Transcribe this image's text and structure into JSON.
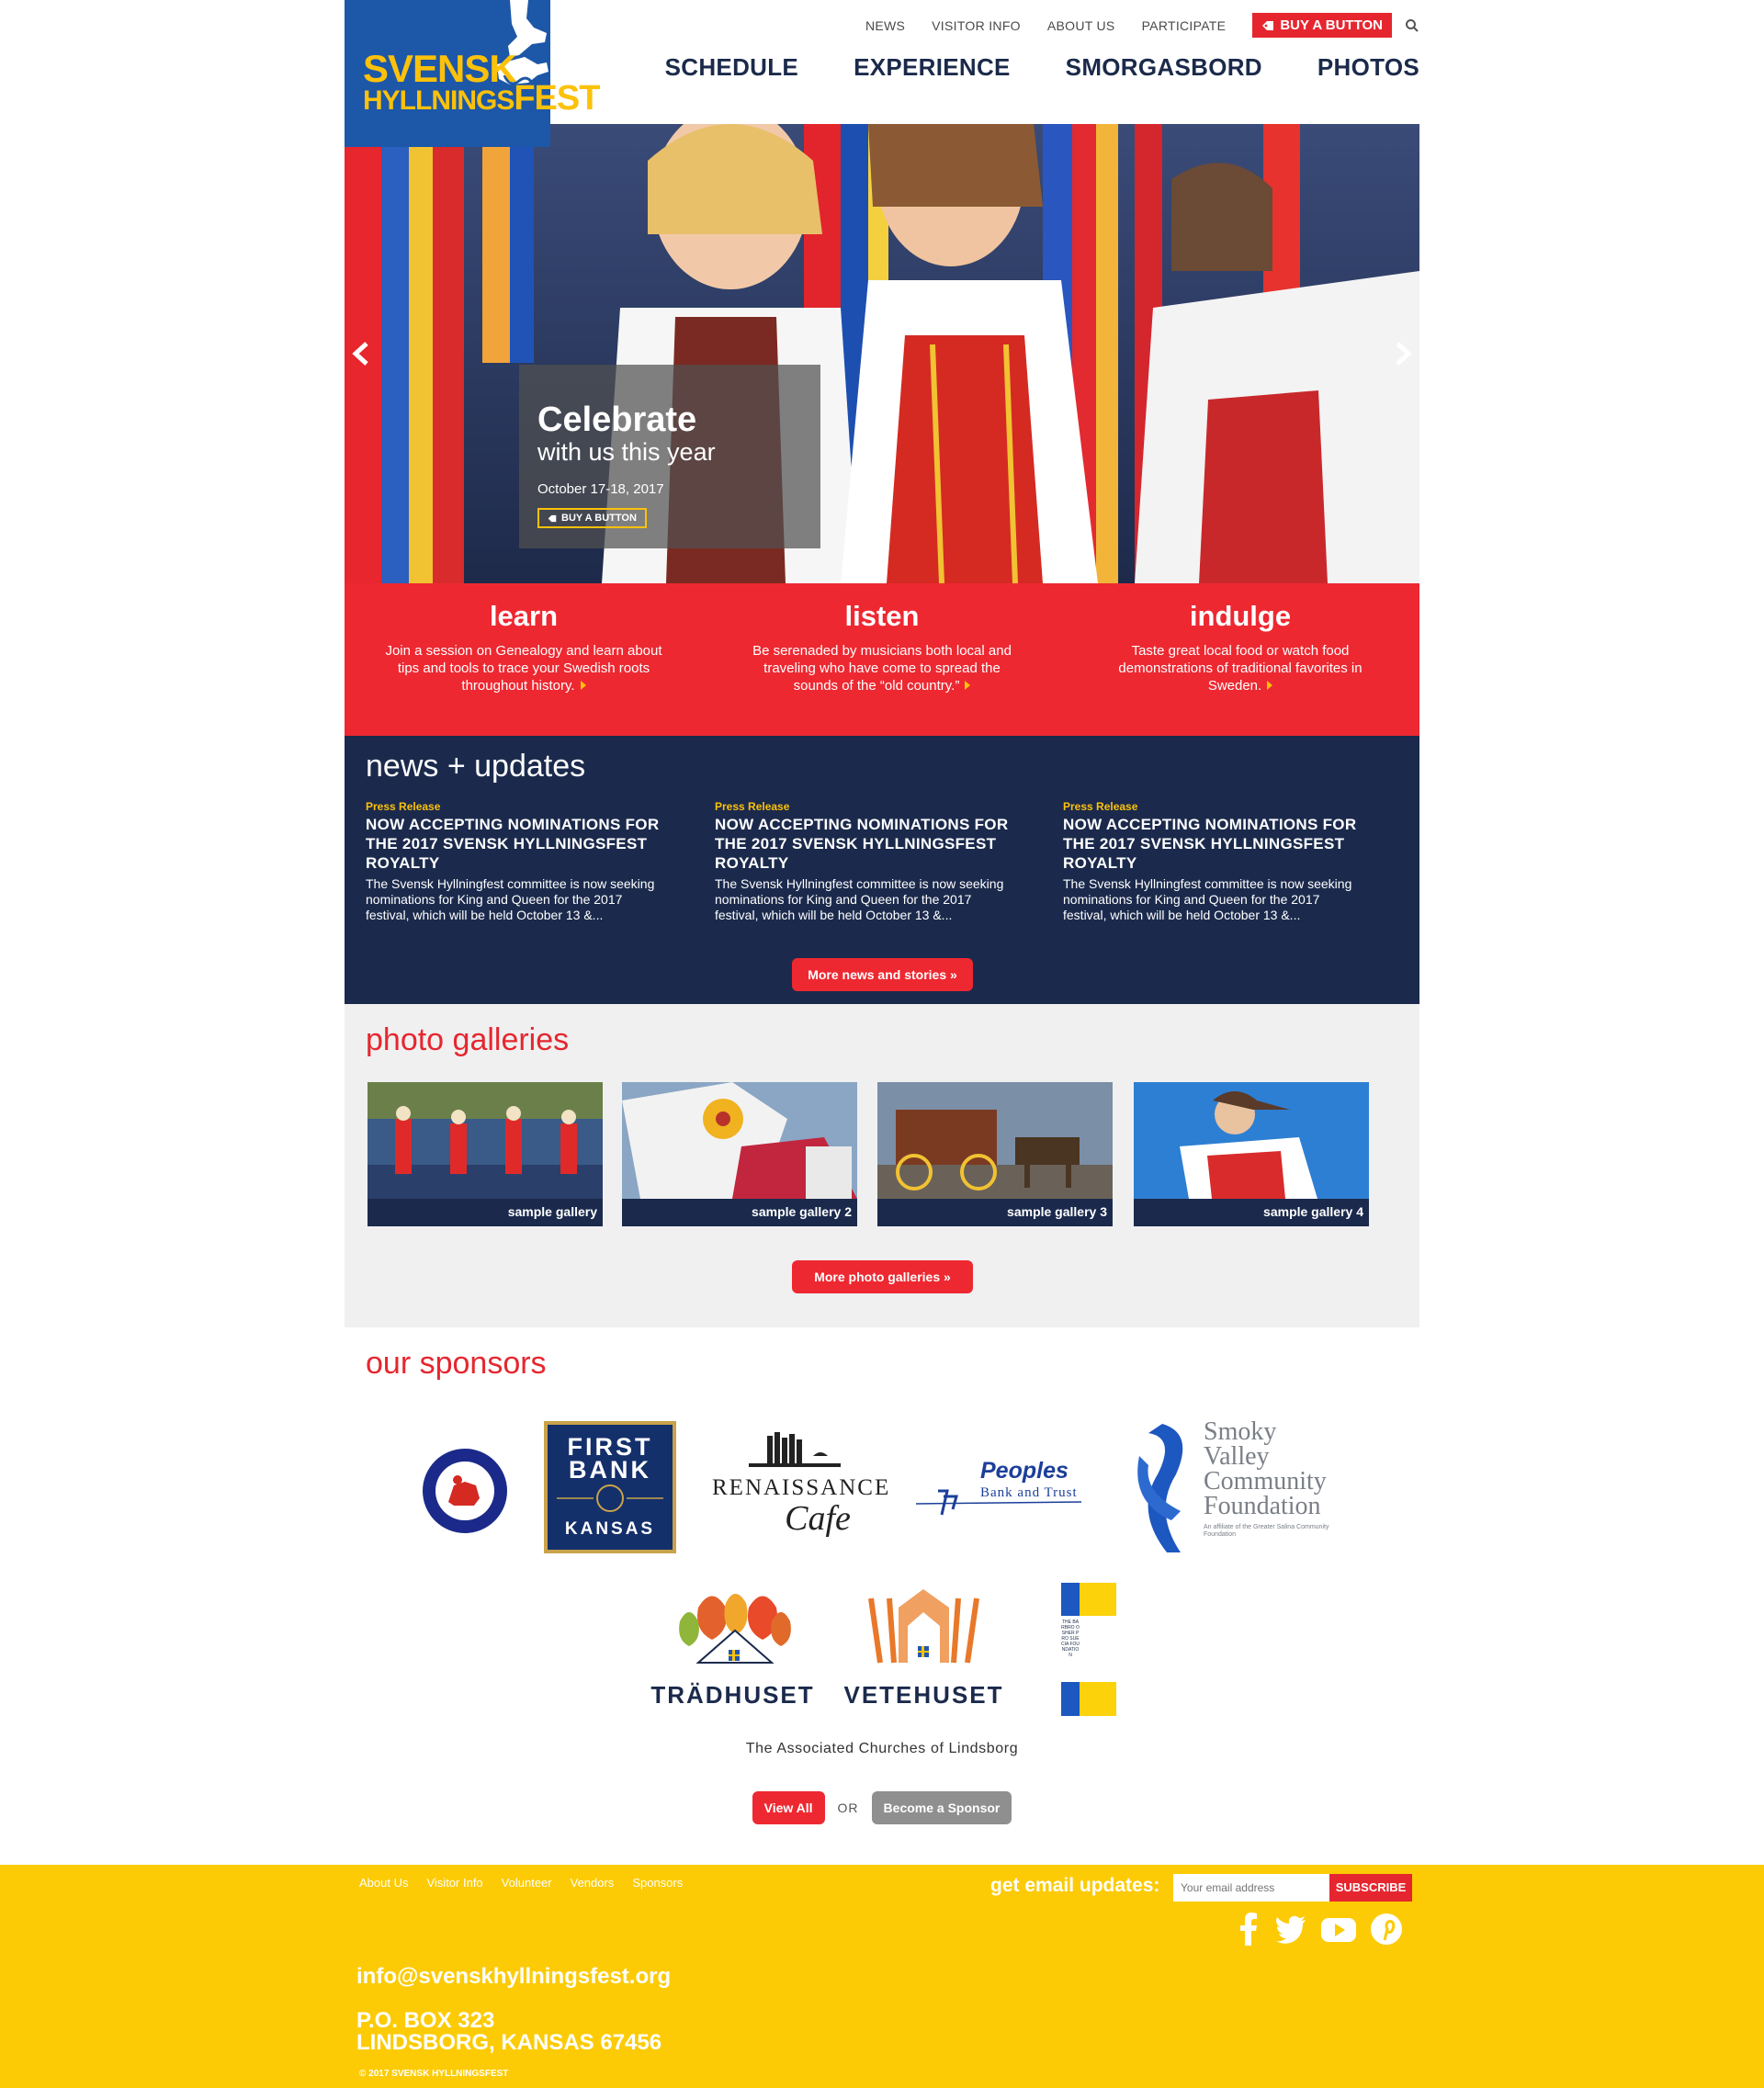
{
  "brand": {
    "logo_line1": "SVENSK",
    "logo_line2a": "HYLLNINGS",
    "logo_line2b": "FEST",
    "blue": "#1d57a8",
    "yellow": "#fcc10a",
    "red": "#ee2831",
    "navy": "#1b2a4c"
  },
  "top_nav": [
    "NEWS",
    "VISITOR INFO",
    "ABOUT US",
    "PARTICIPATE"
  ],
  "top_buy_label": "BUY A BUTTON",
  "main_nav": [
    "SCHEDULE",
    "EXPERIENCE",
    "SMORGASBORD",
    "PHOTOS"
  ],
  "hero": {
    "title": "Celebrate",
    "subtitle": "with us this year",
    "date": "October 17-18, 2017",
    "button": "BUY A BUTTON"
  },
  "features": [
    {
      "title": "learn",
      "text": "Join a session on Genealogy and learn about tips and tools to trace your Swedish roots throughout history."
    },
    {
      "title": "listen",
      "text": "Be serenaded by musicians both local and traveling who have come to spread the sounds of the “old country.”"
    },
    {
      "title": "indulge",
      "text": "Taste great local food or watch food demonstrations of traditional favorites in Sweden."
    }
  ],
  "news": {
    "title": "news + updates",
    "items": [
      {
        "tag": "Press Release",
        "headline": "NOW ACCEPTING NOMINATIONS FOR THE 2017 SVENSK HYLLNINGSFEST ROYALTY",
        "body": "The Svensk Hyllningfest committee is now seeking nominations for King and Queen for the 2017 festival, which will be held October 13 &..."
      },
      {
        "tag": "Press Release",
        "headline": "NOW ACCEPTING NOMINATIONS FOR THE 2017 SVENSK HYLLNINGSFEST ROYALTY",
        "body": "The Svensk Hyllningfest committee is now seeking nominations for King and Queen for the 2017 festival, which will be held October 13 &..."
      },
      {
        "tag": "Press Release",
        "headline": "NOW ACCEPTING NOMINATIONS FOR THE 2017 SVENSK HYLLNINGSFEST ROYALTY",
        "body": "The Svensk Hyllningfest committee is now seeking nominations for King and Queen for the 2017 festival, which will be held October 13 &..."
      }
    ],
    "more_button": "More news and stories »"
  },
  "galleries": {
    "title": "photo galleries",
    "items": [
      "sample gallery",
      "sample gallery 2",
      "sample gallery 3",
      "sample gallery 4"
    ],
    "more_button": "More photo galleries »"
  },
  "sponsors": {
    "title": "our sponsors",
    "city_seal": "THE CITY OF LINDSBORG, KANSAS · VÄLKOMMEN",
    "first_bank_1": "FIRST",
    "first_bank_2": "BANK",
    "first_bank_3": "KANSAS",
    "renaissance_1": "RENAISSANCE",
    "renaissance_2": "Cafe",
    "peoples_1": "Peoples",
    "peoples_2": "Bank and Trust",
    "smoky_1": "Smoky",
    "smoky_2": "Valley",
    "smoky_3": "Community",
    "smoky_4": "Foundation",
    "smoky_5": "An affiliate of the Greater Salina Community Foundation",
    "tradhuset": "TRÄDHUSET",
    "vetehuset": "VETEHUSET",
    "barbro": "THE BARBRO OSHER PRO SUECIA FOUNDATION",
    "associated": "The Associated Churches of Lindsborg",
    "view_all": "View All",
    "or": "OR",
    "become": "Become a Sponsor"
  },
  "footer": {
    "links": [
      "About Us",
      "Visitor Info",
      "Volunteer",
      "Vendors",
      "Sponsors"
    ],
    "email_label": "get email updates:",
    "email_placeholder": "Your email address",
    "subscribe": "SUBSCRIBE",
    "email": "info@svenskhyllningsfest.org",
    "address_1": "P.O. BOX 323",
    "address_2": "LINDSBORG, KANSAS 67456",
    "copyright": "© 2017 SVENSK HYLLNINGSFEST"
  }
}
